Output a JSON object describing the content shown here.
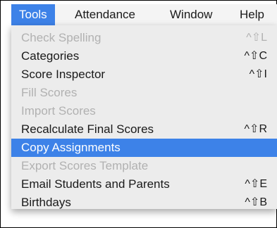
{
  "menubar": {
    "items": [
      {
        "label": "Tools",
        "active": true
      },
      {
        "label": "Attendance"
      },
      {
        "label": "Window"
      },
      {
        "label": "Help"
      }
    ]
  },
  "tools_menu": {
    "items": [
      {
        "label": "Check Spelling",
        "shortcut": "^⇧L",
        "enabled": false
      },
      {
        "label": "Categories",
        "shortcut": "^⇧C",
        "enabled": true
      },
      {
        "label": "Score Inspector",
        "shortcut": "^⇧I",
        "enabled": true
      },
      {
        "label": "Fill Scores",
        "shortcut": "",
        "enabled": false
      },
      {
        "label": "Import Scores",
        "shortcut": "",
        "enabled": false
      },
      {
        "label": "Recalculate Final Scores",
        "shortcut": "^⇧R",
        "enabled": true
      },
      {
        "label": "Copy Assignments",
        "shortcut": "",
        "enabled": true,
        "highlighted": true
      },
      {
        "label": "Export Scores Template",
        "shortcut": "",
        "enabled": false
      },
      {
        "label": "Email Students and Parents",
        "shortcut": "^⇧E",
        "enabled": true
      },
      {
        "label": "Birthdays",
        "shortcut": "^⇧B",
        "enabled": true
      }
    ]
  },
  "colors": {
    "highlight": "#3d82e8",
    "disabled_text": "#b1b1b1",
    "menu_background": "#ececec"
  }
}
